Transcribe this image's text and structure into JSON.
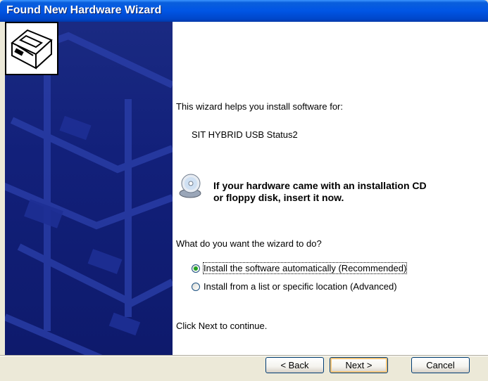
{
  "window": {
    "title": "Found New Hardware Wizard"
  },
  "main": {
    "intro": "This wizard helps you install software for:",
    "device_name": "SIT HYBRID USB Status2",
    "cd_prompt_line1": "If your hardware came with an installation CD",
    "cd_prompt_line2": "or floppy disk, insert it now.",
    "question": "What do you want the wizard to do?",
    "options": [
      {
        "label": "Install the software automatically (Recommended)",
        "selected": true
      },
      {
        "label": "Install from a list or specific location (Advanced)",
        "selected": false
      }
    ],
    "next_hint": "Click Next to continue."
  },
  "buttons": {
    "back": "< Back",
    "next": "Next >",
    "cancel": "Cancel"
  }
}
